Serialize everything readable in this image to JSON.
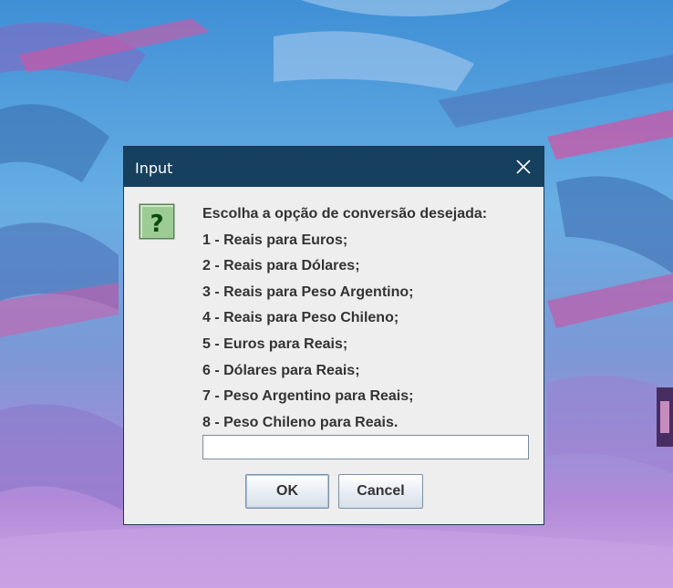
{
  "dialog": {
    "title": "Input",
    "close_icon": "close-icon",
    "question_icon": "question-icon",
    "message_lines": [
      "Escolha a opção de conversão desejada:",
      "1 - Reais para Euros;",
      "2 - Reais para Dólares;",
      "3 - Reais para Peso Argentino;",
      "4 - Reais para Peso Chileno;",
      "5 - Euros para Reais;",
      "6 - Dólares para Reais;",
      "7 - Peso Argentino para Reais;",
      "8 - Peso Chileno para Reais."
    ],
    "input_value": "",
    "ok_label": "OK",
    "cancel_label": "Cancel"
  },
  "colors": {
    "titlebar": "#17405e",
    "dialog_bg": "#eeeeee",
    "icon_bg": "#9ccc94",
    "icon_glyph": "#0a4a0a"
  }
}
